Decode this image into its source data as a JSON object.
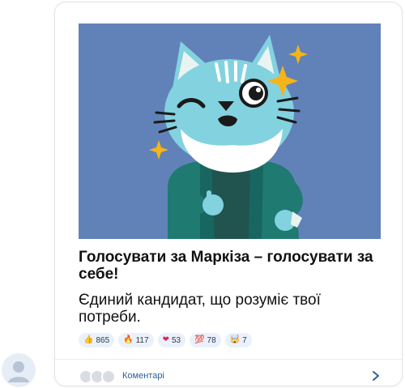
{
  "post": {
    "headline": "Голосувати за Маркіза – голосувати за себе!",
    "body": "Єдиний кандидат, що розуміє твої потреби.",
    "image_description": "cat-sticker-illustration"
  },
  "reactions": [
    {
      "icon": "thumbs-up-icon",
      "glyph": "👍",
      "count": "865"
    },
    {
      "icon": "fire-icon",
      "glyph": "🔥",
      "count": "117"
    },
    {
      "icon": "heart-icon",
      "glyph": "❤",
      "count": "53"
    },
    {
      "icon": "hundred-icon",
      "glyph": "💯",
      "count": "78"
    },
    {
      "icon": "exploding-head-icon",
      "glyph": "🤯",
      "count": "7"
    }
  ],
  "footer": {
    "comments_label": "Коментарі"
  },
  "colors": {
    "illustration_bg": "#6182b8",
    "reaction_bg": "#eaf1fb",
    "link": "#2d5f95",
    "accent_star": "#f4b41a"
  }
}
